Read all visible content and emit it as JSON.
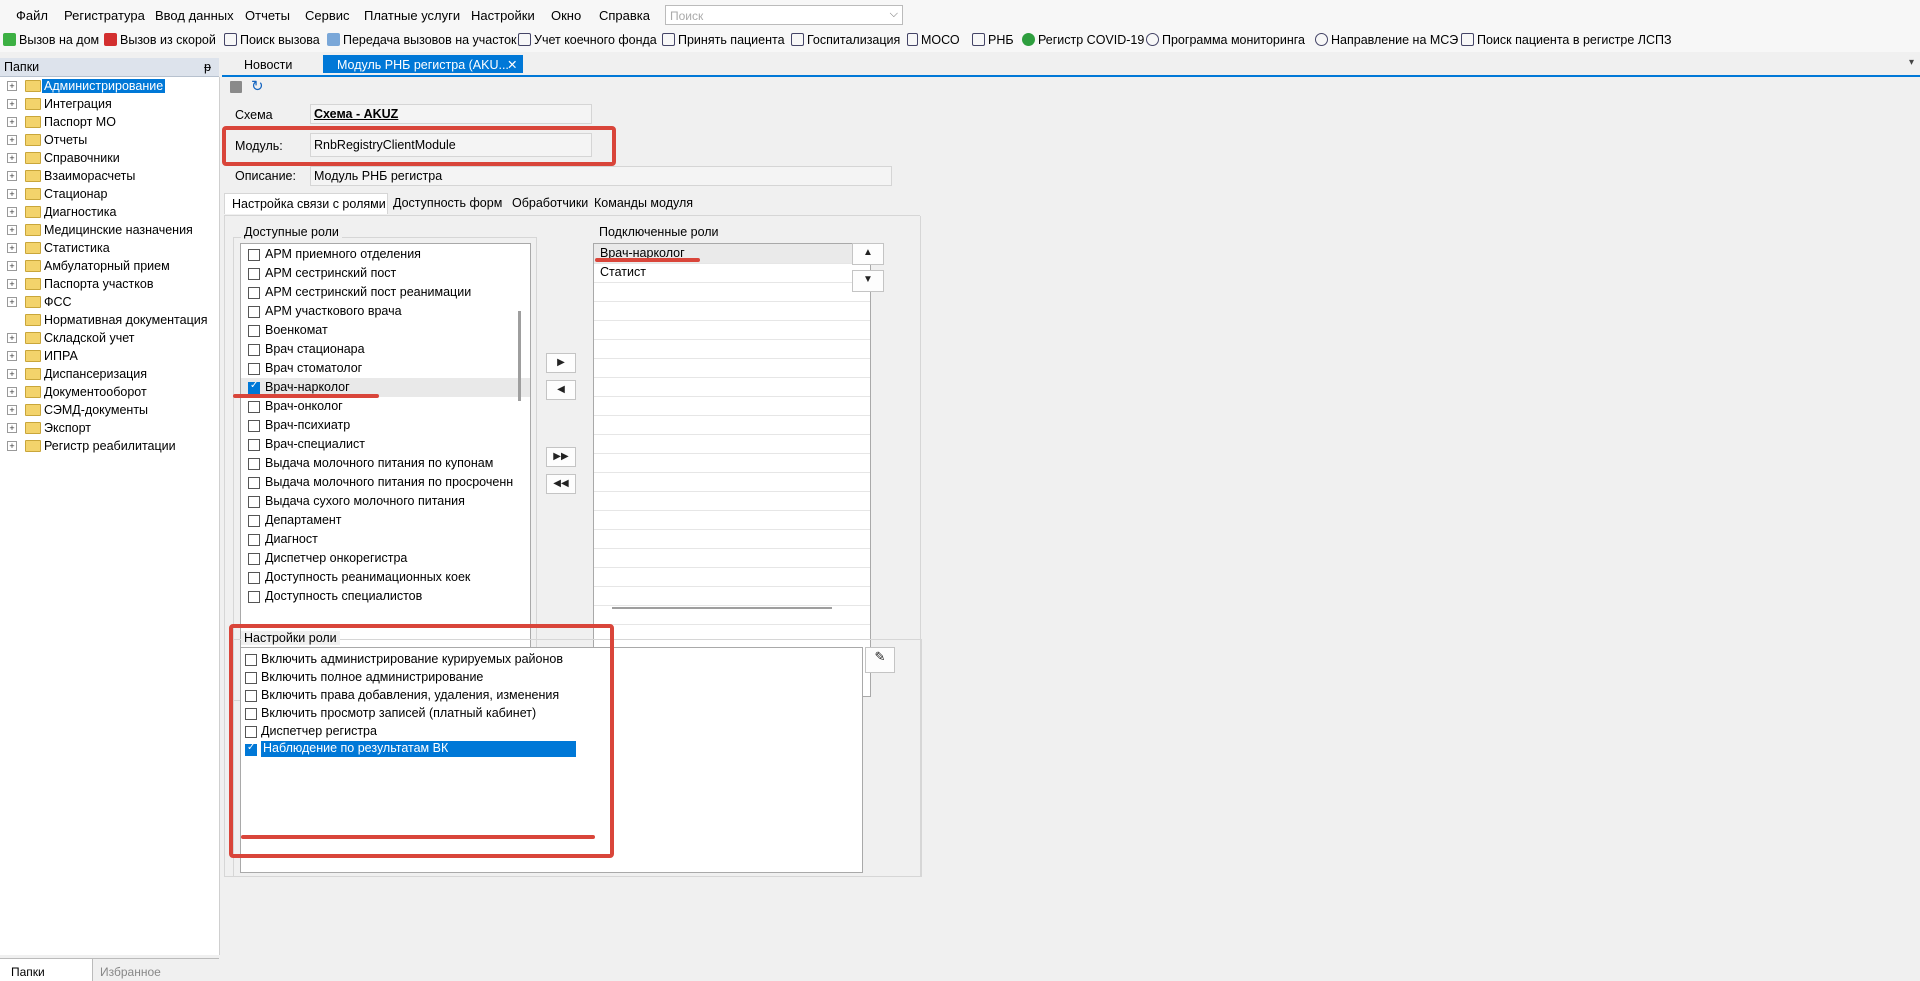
{
  "menu": [
    "Файл",
    "Регистратура",
    "Ввод данных",
    "Отчеты",
    "Сервис",
    "Платные услуги",
    "Настройки",
    "Окно",
    "Справка"
  ],
  "search": {
    "placeholder": "Поиск"
  },
  "toolbar": [
    "Вызов на дом",
    "Вызов из скорой",
    "Поиск вызова",
    "Передача вызовов на участок",
    "Учет коечного фонда",
    "Принять пациента",
    "Госпитализация",
    "МОСО",
    "РНБ",
    "Регистр COVID-19",
    "Программа мониторинга",
    "Направление на МСЭ",
    "Поиск пациента в регистре ЛСПЗ"
  ],
  "left_panel": {
    "title": "Папки",
    "pin": "ᵽ",
    "tree": [
      "Администрирование",
      "Интеграция",
      "Паспорт МО",
      "Отчеты",
      "Справочники",
      "Взаиморасчеты",
      "Стационар",
      "Диагностика",
      "Медицинские назначения",
      "Статистика",
      "Амбулаторный прием",
      "Паспорта участков",
      "ФСС",
      "Нормативная документация",
      "Складской учет",
      "ИПРА",
      "Диспансеризация",
      "Документооборот",
      "СЭМД-документы",
      "Экспорт",
      "Регистр реабилитации"
    ],
    "selected": "Администрирование",
    "tabs": [
      "Папки",
      "Избранное"
    ]
  },
  "doc_tabs": [
    "Новости",
    "Модуль РНБ регистра (AKU...",
    "✕"
  ],
  "form": {
    "schema_label": "Схема",
    "schema_value": "Схема - AKUZ",
    "module_label": "Модуль:",
    "module_value": "RnbRegistryClientModule",
    "desc_label": "Описание:",
    "desc_value": "Модуль РНБ регистра"
  },
  "sub_tabs": [
    "Настройка связи с ролями",
    "Доступность форм",
    "Обработчики",
    "Команды модуля"
  ],
  "available_roles": {
    "title": "Доступные роли",
    "items": [
      {
        "label": "АРМ приемного отделения",
        "checked": false
      },
      {
        "label": "АРМ сестринский пост",
        "checked": false
      },
      {
        "label": "АРМ сестринский пост реанимации",
        "checked": false
      },
      {
        "label": "АРМ участкового врача",
        "checked": false
      },
      {
        "label": "Военкомат",
        "checked": false
      },
      {
        "label": "Врач стационара",
        "checked": false
      },
      {
        "label": "Врач стоматолог",
        "checked": false
      },
      {
        "label": "Врач-нарколог",
        "checked": true
      },
      {
        "label": "Врач-онколог",
        "checked": false
      },
      {
        "label": "Врач-психиатр",
        "checked": false
      },
      {
        "label": "Врач-специалист",
        "checked": false
      },
      {
        "label": "Выдача молочного питания по купонам",
        "checked": false
      },
      {
        "label": "Выдача молочного питания по просроченн",
        "checked": false
      },
      {
        "label": "Выдача сухого молочного питания",
        "checked": false
      },
      {
        "label": "Департамент",
        "checked": false
      },
      {
        "label": "Диагност",
        "checked": false
      },
      {
        "label": "Диспетчер онкорегистра",
        "checked": false
      },
      {
        "label": "Доступность реанимационных коек",
        "checked": false
      },
      {
        "label": "Доступность специалистов",
        "checked": false
      }
    ]
  },
  "connected_roles": {
    "title": "Подключенные роли",
    "items": [
      "Врач-нарколог",
      "Статист"
    ]
  },
  "move_buttons": [
    "▶",
    "◀",
    "▶▶",
    "◀◀"
  ],
  "order_buttons": [
    "▲",
    "▼"
  ],
  "role_settings": {
    "title": "Настройки роли",
    "items": [
      {
        "label": "Включить администрирование курируемых районов",
        "checked": false
      },
      {
        "label": "Включить полное администрирование",
        "checked": false
      },
      {
        "label": "Включить права добавления, удаления, изменения",
        "checked": false
      },
      {
        "label": "Включить просмотр записей (платный кабинет)",
        "checked": false
      },
      {
        "label": "Диспетчер регистра",
        "checked": false
      },
      {
        "label": "Наблюдение по результатам ВК",
        "checked": true
      }
    ],
    "edit_icon": "pencil-icon"
  },
  "colors": {
    "accent": "#0078d7",
    "annotation": "#d9453a",
    "folder": "#f3d36b"
  }
}
